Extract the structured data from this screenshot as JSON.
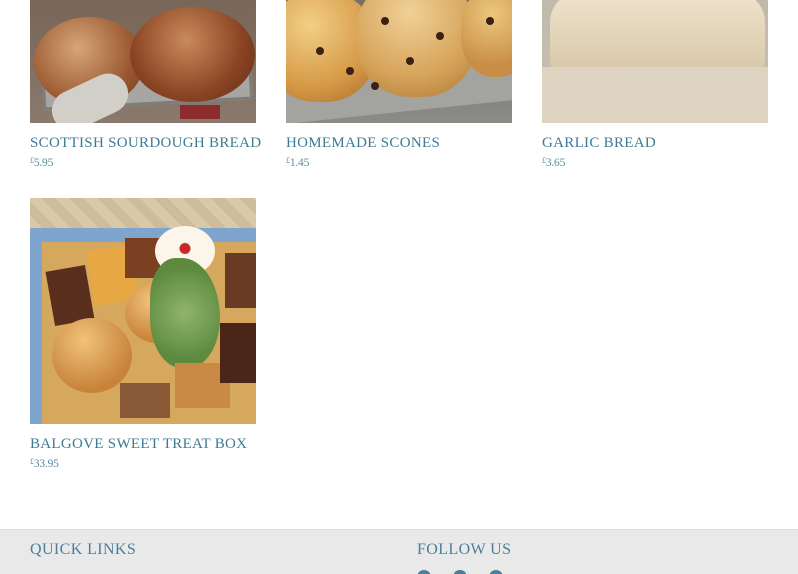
{
  "products": [
    {
      "name": "SCOTTISH SOURDOUGH BREAD",
      "currency": "£",
      "price": "5.95"
    },
    {
      "name": "HOMEMADE SCONES",
      "currency": "£",
      "price": "1.45"
    },
    {
      "name": "GARLIC BREAD",
      "currency": "£",
      "price": "3.65"
    },
    {
      "name": "BALGOVE SWEET TREAT BOX",
      "currency": "£",
      "price": "33.95"
    }
  ],
  "footer": {
    "quick_links_heading": "QUICK LINKS",
    "follow_us_heading": "FOLLOW US",
    "social_icons": [
      "facebook-icon",
      "twitter-icon",
      "instagram-icon"
    ]
  },
  "colors": {
    "link_text": "#3d7a95",
    "footer_bg": "#e9e9e9"
  }
}
